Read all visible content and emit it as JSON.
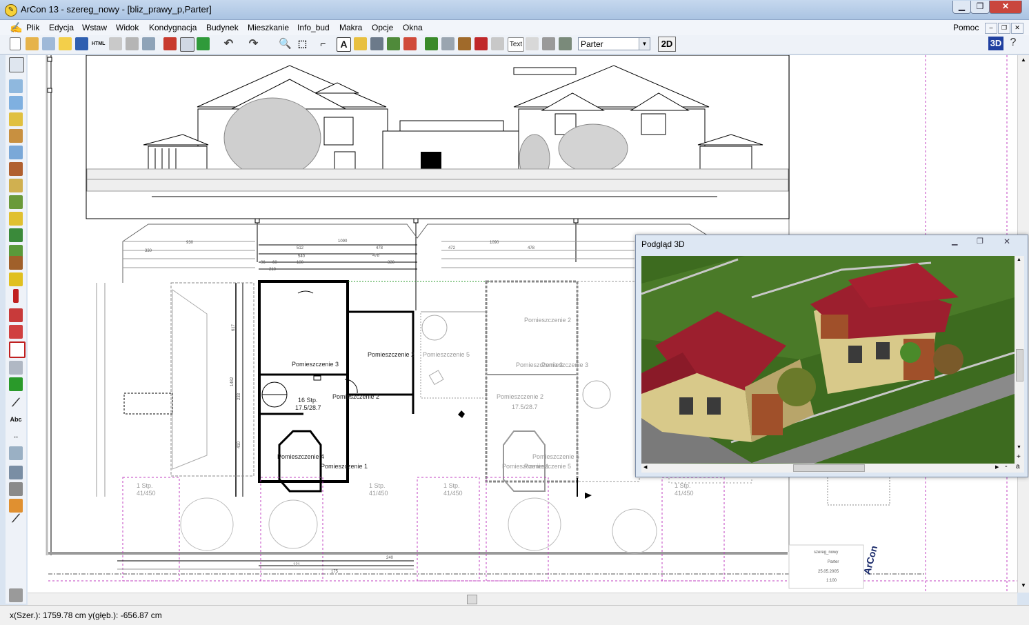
{
  "window": {
    "title": "ArCon 13 - szereg_nowy - [bliz_prawy_p,Parter]"
  },
  "menu": {
    "items": [
      "Plik",
      "Edycja",
      "Wstaw",
      "Widok",
      "Kondygnacja",
      "Budynek",
      "Mieszkanie",
      "Info_bud",
      "Makra",
      "Opcje",
      "Okna"
    ],
    "help": "Pomoc"
  },
  "toolbar": {
    "text_tool": "Text",
    "floor_selected": "Parter",
    "view_2d": "2D",
    "view_3d": "3D"
  },
  "lefttools": {
    "text_label": "Abc"
  },
  "preview": {
    "title": "Podgląd 3D",
    "plus": "+",
    "minus": "-",
    "a": "a"
  },
  "plan": {
    "rooms": {
      "r1": "Pomieszczenie 1",
      "r2": "Pomieszczenie 2",
      "r3": "Pomieszczenie 3",
      "r4": "Pomieszczenie 4",
      "r5": "Pomieszczenie 5",
      "r2b": "Pomieszczenie 2",
      "r3b": "Pomieszczenie 3",
      "r5b": "Pomieszczenie 5",
      "r1b": "Pomieszczenie 1",
      "r2c": "Pomieszczenie 2",
      "r2d": "Pomieszczenie 2",
      "r5c": "Pomieszczenie 5"
    },
    "stairs": {
      "s16": "16 Stp.",
      "s16dim": "17.5/28.7",
      "s16b": "16 Stp.",
      "s16bdim": "17.5/28.7",
      "s1a": "1 Stp.",
      "s1adim": "41/450",
      "s1b": "1 Stp.",
      "s1bdim": "41/450",
      "s1c": "1 Stp.",
      "s1cdim": "41/450",
      "s1d": "1 Stp.",
      "s1ddim": "41/450"
    },
    "dims": {
      "d1090": "1090",
      "d512": "512",
      "d478": "478",
      "d540": "540",
      "d330": "330",
      "d180": "180",
      "d96": "96",
      "d60": "60",
      "d210": "210",
      "d1090b": "1090",
      "d930": "930",
      "d472": "472",
      "d617": "617",
      "d1482": "1482",
      "d233": "233",
      "d410": "410",
      "d240": "240",
      "d175": "175",
      "d121": "121"
    },
    "stamp": {
      "project": "szereg_nowy",
      "floor": "Parter",
      "date": "25.05.2005",
      "scale": "1:100",
      "logo": "ArCon"
    }
  },
  "status": {
    "coords": "x(Szer.): 1759.78 cm  y(głęb.): -656.87 cm"
  },
  "colors": {
    "dim_magenta": "#c040c0",
    "wall_black": "#000000",
    "roof_red": "#9c1f2e",
    "grass": "#3d6b1f",
    "wall_yellow": "#d8c98a"
  }
}
